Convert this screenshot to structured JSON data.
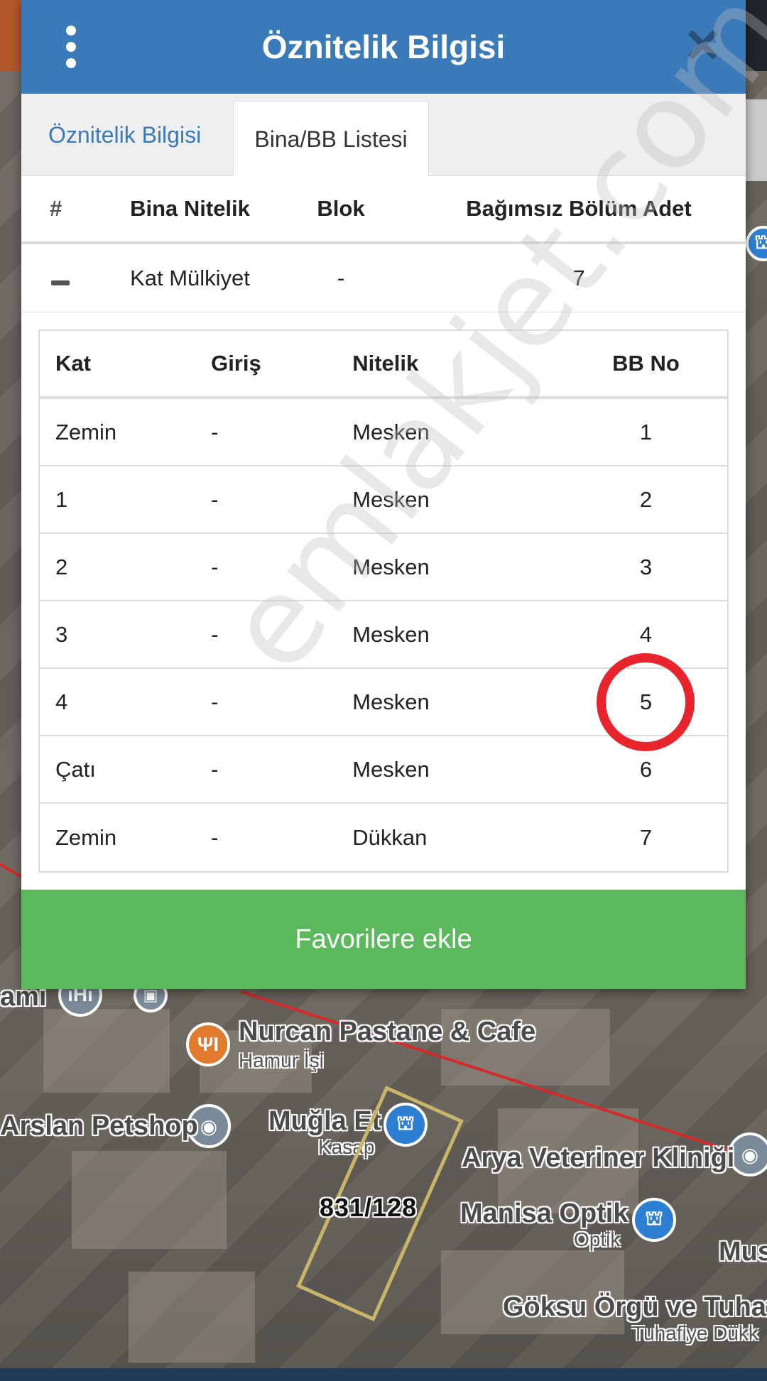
{
  "modal": {
    "title": "Öznitelik Bilgisi",
    "tabs": [
      {
        "label": "Öznitelik Bilgisi",
        "active": false
      },
      {
        "label": "Bina/BB Listesi",
        "active": true
      }
    ],
    "bina_table": {
      "headers": [
        "#",
        "Bina Nitelik",
        "Blok",
        "Bağımsız Bölüm Adet"
      ],
      "row": {
        "nitelik": "Kat Mülkiyet",
        "blok": "-",
        "adet": "7"
      }
    },
    "bb_table": {
      "headers": [
        "Kat",
        "Giriş",
        "Nitelik",
        "BB No"
      ],
      "rows": [
        {
          "kat": "Zemin",
          "giris": "-",
          "nitelik": "Mesken",
          "bbno": "1"
        },
        {
          "kat": "1",
          "giris": "-",
          "nitelik": "Mesken",
          "bbno": "2"
        },
        {
          "kat": "2",
          "giris": "-",
          "nitelik": "Mesken",
          "bbno": "3"
        },
        {
          "kat": "3",
          "giris": "-",
          "nitelik": "Mesken",
          "bbno": "4"
        },
        {
          "kat": "4",
          "giris": "-",
          "nitelik": "Mesken",
          "bbno": "5"
        },
        {
          "kat": "Çatı",
          "giris": "-",
          "nitelik": "Mesken",
          "bbno": "6"
        },
        {
          "kat": "Zemin",
          "giris": "-",
          "nitelik": "Dükkan",
          "bbno": "7"
        }
      ],
      "highlighted_bbno": "5"
    },
    "favorite_button": "Favorilere ekle",
    "watermark": "emlakjet.com"
  },
  "map": {
    "labels": [
      {
        "text": "Nurcan Pastane & Cafe",
        "sub": "Hamur İşi"
      },
      {
        "text": "Arslan Petshop"
      },
      {
        "text": "Muğla Et",
        "sub": "Kasap"
      },
      {
        "text": "Arya Veteriner Kliniği"
      },
      {
        "text": "Manisa Optik",
        "sub": "Optik"
      },
      {
        "text": "Göksu Örgü ve Tuhafi",
        "sub": "Tuhafiye Dükk"
      },
      {
        "text": "Mus"
      },
      {
        "text": "ami"
      }
    ],
    "parcel": "831/128",
    "colors": {
      "road": "#d42a2a",
      "parcel": "#c9b56a"
    }
  },
  "colors": {
    "header": "#3a7ab9",
    "button": "#5cb85c",
    "highlight": "#e8242c",
    "tab_active_text": "#333333",
    "tab_link": "#3a7ab9"
  }
}
